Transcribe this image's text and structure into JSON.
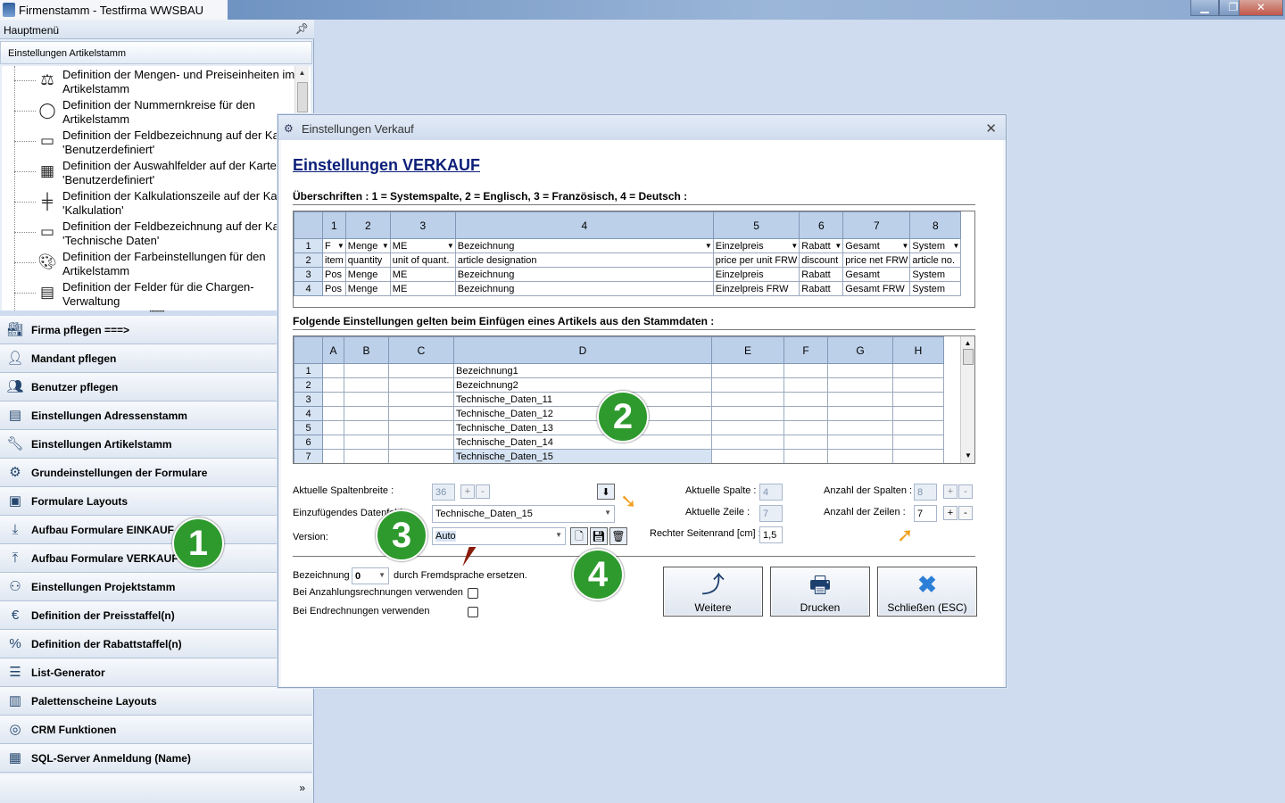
{
  "window": {
    "title": "Firmenstamm - Testfirma WWSBAU",
    "min_icon": "minimize-icon",
    "max_icon": "maximize-icon",
    "close_icon": "close-icon"
  },
  "sidebar": {
    "header": "Hauptmenü",
    "pin_icon": "pin-icon",
    "section_title": "Einstellungen Artikelstamm",
    "tree_items": [
      {
        "label": "Definition der Mengen- und Preiseinheiten im Artikelstamm",
        "icon": "scale-icon"
      },
      {
        "label": "Definition der Nummernkreise für den Artikelstamm",
        "icon": "circle-icon"
      },
      {
        "label": "Definition der Feldbezeichnung auf der Karte 'Benutzerdefiniert'",
        "icon": "form-icon"
      },
      {
        "label": "Definition der Auswahlfelder auf der Karte 'Benutzerdefiniert'",
        "icon": "list-icon"
      },
      {
        "label": "Definition der Kalkulationszeile auf der Karte 'Kalkulation'",
        "icon": "ruler-icon"
      },
      {
        "label": "Definition der Feldbezeichnung auf der Karte 'Technische Daten'",
        "icon": "form-icon"
      },
      {
        "label": "Definition der Farbeinstellungen für den Artikelstamm",
        "icon": "palette-icon"
      },
      {
        "label": "Definition der Felder für die Chargen-Verwaltung",
        "icon": "grid-icon"
      }
    ],
    "nav": [
      {
        "label": "Firma pflegen   ===>",
        "icon": "factory-icon"
      },
      {
        "label": "Mandant pflegen",
        "icon": "user-computer-icon"
      },
      {
        "label": "Benutzer pflegen",
        "icon": "users-icon"
      },
      {
        "label": "Einstellungen Adressenstamm",
        "icon": "address-card-icon"
      },
      {
        "label": "Einstellungen Artikelstamm",
        "icon": "tools-icon"
      },
      {
        "label": "Grundeinstellungen der Formulare",
        "icon": "settings-doc-icon"
      },
      {
        "label": "Formulare Layouts",
        "icon": "layout-icon"
      },
      {
        "label": "Aufbau Formulare EINKAUF",
        "icon": "download-icon"
      },
      {
        "label": "Aufbau Formulare VERKAUF",
        "icon": "upload-icon"
      },
      {
        "label": "Einstellungen Projektstamm",
        "icon": "project-icon"
      },
      {
        "label": "Definition der Preisstaffel(n)",
        "icon": "price-scale-icon"
      },
      {
        "label": "Definition der Rabattstaffel(n)",
        "icon": "discount-icon"
      },
      {
        "label": "List-Generator",
        "icon": "list-generator-icon"
      },
      {
        "label": "Palettenscheine Layouts",
        "icon": "pallet-icon"
      },
      {
        "label": "CRM Funktionen",
        "icon": "crm-icon"
      },
      {
        "label": "SQL-Server Anmeldung (Name)",
        "icon": "sql-server-icon"
      }
    ],
    "footer_icon": "chevron-down-icon"
  },
  "dialog": {
    "title": "Einstellungen Verkauf",
    "close_icon": "close-icon",
    "heading": "Einstellungen VERKAUF",
    "section1_label": "Überschriften : 1 = Systemspalte, 2 = Englisch, 3 = Französisch, 4 = Deutsch :",
    "grid1": {
      "columns": [
        "1",
        "2",
        "3",
        "4",
        "5",
        "6",
        "7",
        "8"
      ],
      "rows": [
        {
          "num": "1",
          "cells": [
            "F",
            "Menge",
            "ME",
            "Bezeichnung",
            "Einzelpreis",
            "Rabatt",
            "Gesamt",
            "System"
          ]
        },
        {
          "num": "2",
          "cells": [
            "item",
            "quantity",
            "unit of quant.",
            "article designation",
            "price per unit FRW",
            "discount",
            "price net FRW",
            "article no."
          ]
        },
        {
          "num": "3",
          "cells": [
            "Pos",
            "Menge",
            "ME",
            "Bezeichnung",
            "Einzelpreis",
            "Rabatt",
            "Gesamt",
            "System"
          ]
        },
        {
          "num": "4",
          "cells": [
            "Pos",
            "Menge",
            "ME",
            "Bezeichnung",
            "Einzelpreis FRW",
            "Rabatt",
            "Gesamt FRW",
            "System"
          ]
        }
      ]
    },
    "section2_label": "Folgende Einstellungen gelten beim Einfügen eines Artikels aus den Stammdaten :",
    "grid2": {
      "columns": [
        "A",
        "B",
        "C",
        "D",
        "E",
        "F",
        "G",
        "H"
      ],
      "rows": [
        {
          "num": "1",
          "d": "Bezeichnung1"
        },
        {
          "num": "2",
          "d": "Bezeichnung2"
        },
        {
          "num": "3",
          "d": "Technische_Daten_11"
        },
        {
          "num": "4",
          "d": "Technische_Daten_12"
        },
        {
          "num": "5",
          "d": "Technische_Daten_13"
        },
        {
          "num": "6",
          "d": "Technische_Daten_14"
        },
        {
          "num": "7",
          "d": "Technische_Daten_15"
        }
      ]
    },
    "fields": {
      "col_width_label": "Aktuelle Spaltenbreite :",
      "col_width_value": "36",
      "datafield_label": "Einzufügendes Datenfeld :",
      "datafield_value": "Technische_Daten_15",
      "version_label": "Version:",
      "version_value": "Auto",
      "cur_col_label": "Aktuelle Spalte :",
      "cur_col_value": "4",
      "cur_row_label": "Aktuelle Zeile :",
      "cur_row_value": "7",
      "right_margin_label": "Rechter Seitenrand [cm] :",
      "right_margin_value": "1,5",
      "num_cols_label": "Anzahl der Spalten :",
      "num_cols_value": "8",
      "num_rows_label": "Anzahl der Zeilen :",
      "num_rows_value": "7",
      "plus": "+",
      "minus": "-"
    },
    "options": {
      "bez_prefix": "Bezeichnung",
      "bez_value": "0",
      "bez_suffix": "durch Fremdsprache ersetzen.",
      "anzahlung_label": "Bei Anzahlungsrechnungen verwenden",
      "end_label": "Bei Endrechnungen verwenden"
    },
    "buttons": {
      "weitere": "Weitere",
      "drucken": "Drucken",
      "schliessen": "Schließen (ESC)"
    },
    "badges": [
      "1",
      "2",
      "3",
      "4"
    ]
  },
  "colors": {
    "heading": "#0b1f7a",
    "badge": "#2e9a2e",
    "header_cell": "#bcd0ea"
  }
}
